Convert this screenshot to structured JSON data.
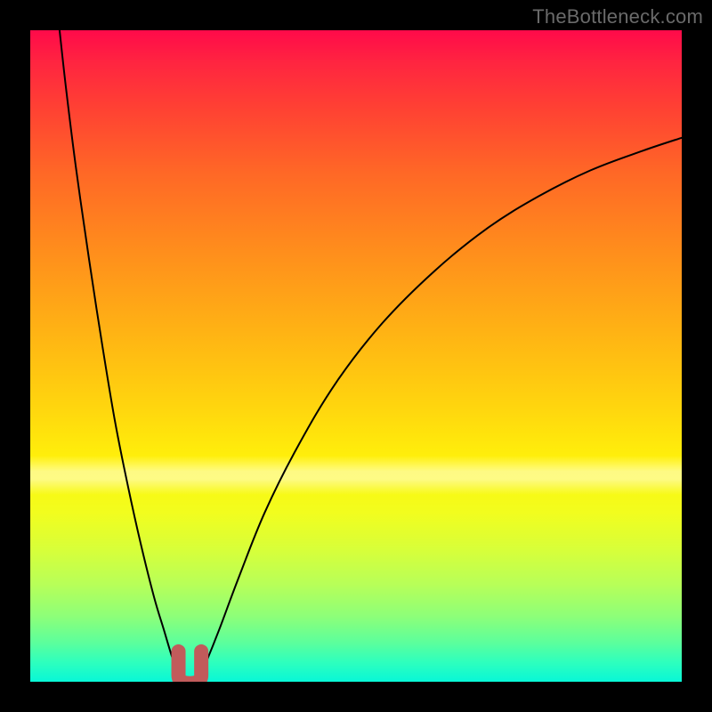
{
  "watermark": "TheBottleneck.com",
  "chart_data": {
    "type": "line",
    "title": "",
    "xlabel": "",
    "ylabel": "",
    "xlim": [
      0,
      100
    ],
    "ylim": [
      0,
      100
    ],
    "grid": false,
    "legend": false,
    "background_gradient": {
      "top": "#ff0a4a",
      "bottom": "#08f7d7",
      "description": "vertical red→orange→yellow→green gradient"
    },
    "series": [
      {
        "name": "left-curve",
        "x": [
          4.5,
          5.5,
          7.0,
          9.0,
          11.0,
          13.0,
          15.0,
          17.0,
          19.0,
          20.5,
          21.7,
          22.6,
          23.3
        ],
        "y": [
          100,
          91,
          79,
          65,
          52,
          40,
          30,
          21,
          13,
          8,
          4,
          1.5,
          0.3
        ]
      },
      {
        "name": "right-curve",
        "x": [
          25.8,
          27.0,
          29.0,
          32.0,
          36.0,
          41.0,
          47.0,
          54.0,
          62.0,
          70.0,
          78.0,
          86.0,
          94.0,
          100.0
        ],
        "y": [
          0.3,
          3.0,
          8.0,
          16.0,
          26.0,
          36.0,
          46.0,
          55.0,
          63.0,
          69.5,
          74.5,
          78.5,
          81.5,
          83.5
        ]
      }
    ],
    "marker": {
      "name": "bottleneck-dip",
      "shape": "u",
      "color": "#c15b5b",
      "x_center": 24.5,
      "y_center": 1.5,
      "approx_width": 3.5,
      "approx_height": 3.5
    },
    "highlight_band": {
      "y_center": 31.5,
      "height": 6
    }
  }
}
